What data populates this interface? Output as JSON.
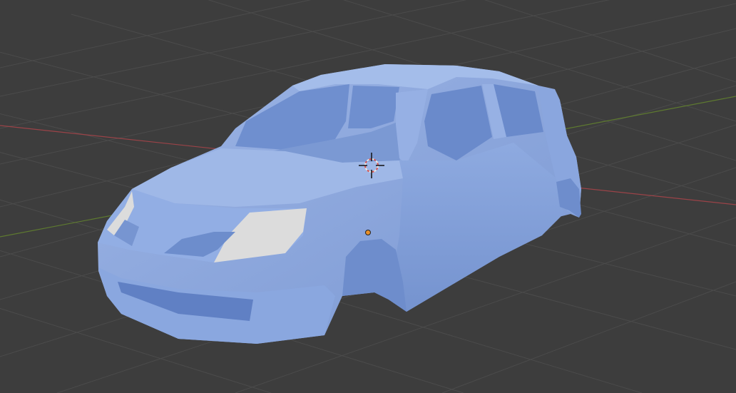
{
  "viewport": {
    "background_color": "#3d3d3d",
    "grid_color": "#4a4a4a",
    "x_axis_color": "#9b4348",
    "y_axis_color": "#5e7a30",
    "object_color": "#8ba8de",
    "object_shade_color": "#7592cc",
    "object_highlight_color": "#a3bdea",
    "headlight_color": "#dcdcdc",
    "origin_color": "#e8902a",
    "object_name": "car body mesh",
    "icons": {
      "cursor": "3d-cursor-icon",
      "origin": "object-origin-icon"
    }
  }
}
